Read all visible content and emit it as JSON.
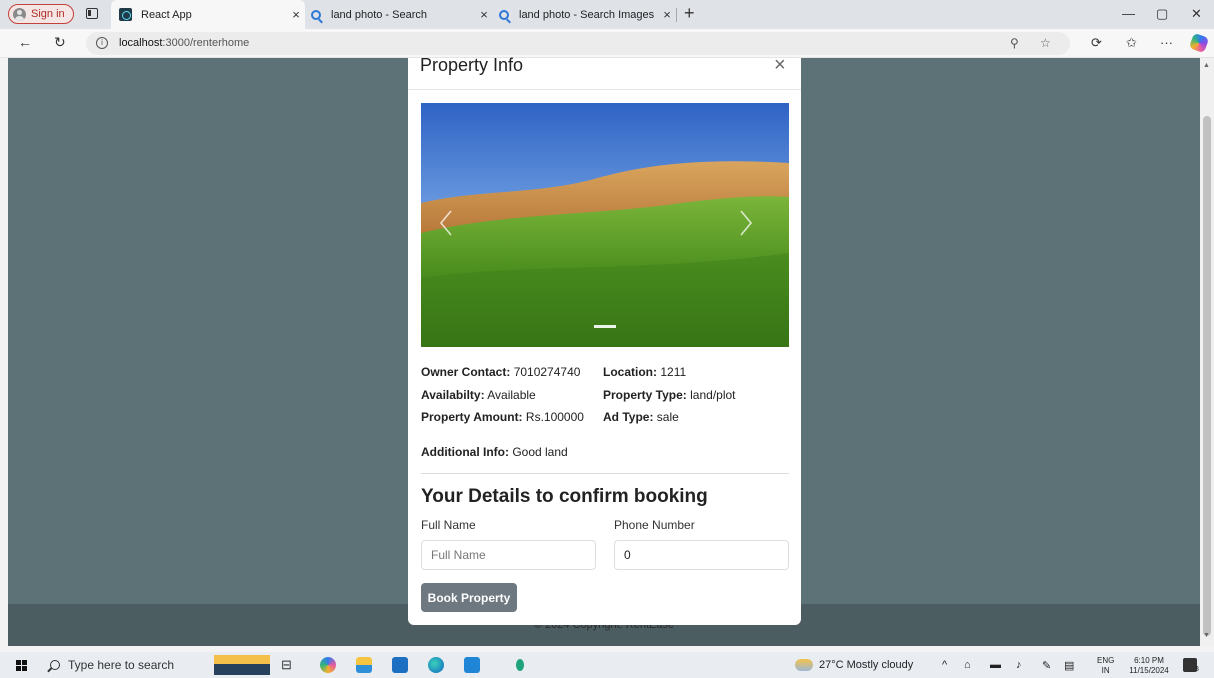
{
  "browser": {
    "signin_label": "Sign in",
    "tabs": [
      {
        "label": "React App",
        "icon": "react-icon"
      },
      {
        "label": "land photo - Search",
        "icon": "search-icon"
      },
      {
        "label": "land photo - Search Images",
        "icon": "search-icon"
      }
    ],
    "url_host": "localhost",
    "url_rest": ":3000/renterhome"
  },
  "modal": {
    "title": "Property Info",
    "close_glyph": "×",
    "details": {
      "owner_contact_label": "Owner Contact:",
      "owner_contact": "7010274740",
      "location_label": "Location:",
      "location": "1211",
      "availability_label": "Availabilty:",
      "availability": "Available",
      "property_type_label": "Property Type:",
      "property_type": "land/plot",
      "amount_label": "Property Amount:",
      "amount": "Rs.100000",
      "ad_type_label": "Ad Type:",
      "ad_type": "sale",
      "additional_label": "Additional Info:",
      "additional": "Good land"
    },
    "booking": {
      "title": "Your Details to confirm booking",
      "fullname_label": "Full Name",
      "fullname_placeholder": "Full Name",
      "phone_label": "Phone Number",
      "phone_value": "0",
      "submit_label": "Book Property"
    }
  },
  "footer": {
    "text": "© 2024 Copyright: RentEase"
  },
  "taskbar": {
    "search_placeholder": "Type here to search",
    "weather": "27°C  Mostly cloudy",
    "lang_top": "ENG",
    "lang_bottom": "IN",
    "time": "6:10 PM",
    "date": "11/15/2024",
    "notification_count": "3"
  },
  "colors": {
    "page_bg": "#5c7277",
    "footer_bg": "#4c5d61",
    "button_bg": "#6e7880",
    "signin_accent": "#c2413b"
  }
}
